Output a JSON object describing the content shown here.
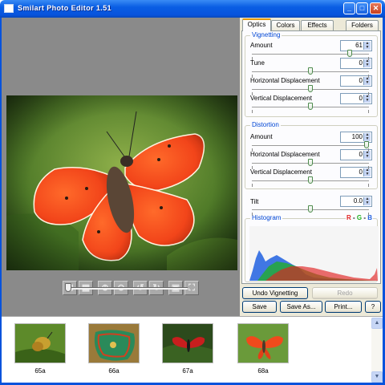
{
  "window": {
    "title": "Smilart Photo Editor 1.51"
  },
  "tabs": [
    {
      "label": "Optics",
      "active": true
    },
    {
      "label": "Colors"
    },
    {
      "label": "Effects"
    },
    {
      "label": "Folders"
    }
  ],
  "vignetting": {
    "title": "Vignetting",
    "amount": {
      "label": "Amount",
      "value": "61",
      "fraction": 0.85
    },
    "tune": {
      "label": "Tune",
      "value": "0",
      "fraction": 0.5
    },
    "hdisp": {
      "label": "Horizontal Displacement",
      "value": "0",
      "fraction": 0.5
    },
    "vdisp": {
      "label": "Vertical Displacement",
      "value": "0",
      "fraction": 0.5
    }
  },
  "distortion": {
    "title": "Distortion",
    "amount": {
      "label": "Amount",
      "value": "100",
      "fraction": 1.0
    },
    "hdisp": {
      "label": "Horizontal Displacement",
      "value": "0",
      "fraction": 0.5
    },
    "vdisp": {
      "label": "Vertical Displacement",
      "value": "0",
      "fraction": 0.5
    }
  },
  "tilt": {
    "label": "Tilt",
    "value": "0.0",
    "fraction": 0.5
  },
  "histogram": {
    "title": "Histogram",
    "r": "R",
    "g": "G",
    "b": "B",
    "sep": "-"
  },
  "buttons": {
    "undo": "Undo Vignetting",
    "redo": "Redo",
    "save": "Save",
    "save_as": "Save As...",
    "print": "Print...",
    "help": "?"
  },
  "toolbar": {
    "icons": [
      "fit-window-icon",
      "actual-size-icon",
      "zoom-in-icon",
      "zoom-out-icon",
      "rotate-left-icon",
      "rotate-right-icon",
      "crop-icon",
      "fullscreen-icon"
    ],
    "zoom_fraction": 0.0
  },
  "thumbnails": [
    {
      "caption": "65a"
    },
    {
      "caption": "66a"
    },
    {
      "caption": "67a"
    },
    {
      "caption": "68a"
    }
  ],
  "colors": {
    "accent": "#0046d5",
    "title_bar": "#0753dc",
    "viewer_bg": "#8a8a8a",
    "panel_bg": "#ece9d8",
    "hist_red": "#e02020",
    "hist_green": "#20b020",
    "hist_blue": "#2060e0"
  }
}
